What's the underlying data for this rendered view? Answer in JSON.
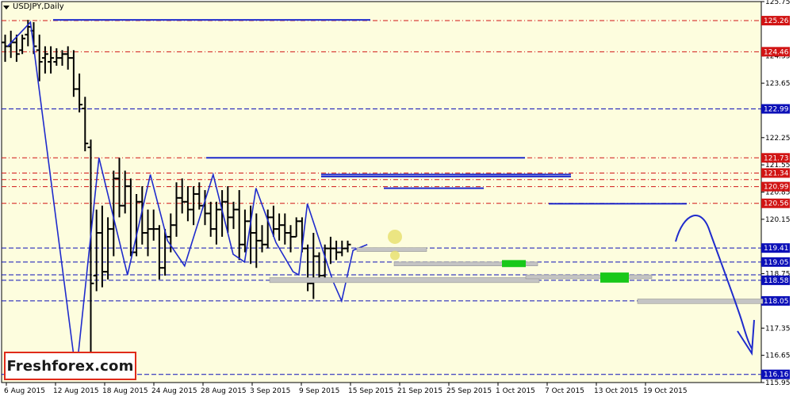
{
  "window": {
    "symbol": "USDJPY,Daily"
  },
  "logo": {
    "text": "Freshforex.com"
  },
  "colors": {
    "background": "#fdfdde",
    "frame": "#000000",
    "bar": "#000000",
    "level_red": "#d11414",
    "level_blue": "#0c10b8",
    "trend_line": "#1f2bcc",
    "support_box": "#c4c4c4",
    "highlight_green": "#18c81a",
    "highlight_yellow": "#e6df6a"
  },
  "chart_data": {
    "type": "bar",
    "title": "USDJPY,Daily",
    "xlabel": "",
    "ylabel": "",
    "ylim": [
      115.95,
      125.75
    ],
    "grid": false,
    "x_tick_labels": [
      {
        "label": "6 Aug 2015",
        "index": 0
      },
      {
        "label": "12 Aug 2015",
        "index": 4
      },
      {
        "label": "18 Aug 2015",
        "index": 8
      },
      {
        "label": "24 Aug 2015",
        "index": 12
      },
      {
        "label": "28 Aug 2015",
        "index": 16
      },
      {
        "label": "3 Sep 2015",
        "index": 20
      },
      {
        "label": "9 Sep 2015",
        "index": 24
      },
      {
        "label": "15 Sep 2015",
        "index": 28
      },
      {
        "label": "21 Sep 2015",
        "index": 32
      },
      {
        "label": "25 Sep 2015",
        "index": 36
      },
      {
        "label": "1 Oct 2015",
        "index": 40
      },
      {
        "label": "7 Oct 2015",
        "index": 44
      },
      {
        "label": "13 Oct 2015",
        "index": 48
      },
      {
        "label": "19 Oct 2015",
        "index": 52
      }
    ],
    "y_ticks": [
      "125.75",
      "124.35",
      "123.65",
      "122.25",
      "121.55",
      "120.85",
      "120.15",
      "119.45",
      "118.75",
      "117.35",
      "116.65",
      "115.95"
    ],
    "levels": [
      {
        "value": 125.26,
        "label": "125.26",
        "color": "red"
      },
      {
        "value": 124.46,
        "label": "124.46",
        "color": "red"
      },
      {
        "value": 122.99,
        "label": "122.99",
        "color": "blue"
      },
      {
        "value": 121.73,
        "label": "121.73",
        "color": "red"
      },
      {
        "value": 121.34,
        "label": "121.34",
        "color": "red"
      },
      {
        "value": 121.17,
        "label": "",
        "color": "red"
      },
      {
        "value": 120.99,
        "label": "120.99",
        "color": "red"
      },
      {
        "value": 120.56,
        "label": "120.56",
        "color": "red"
      },
      {
        "value": 119.41,
        "label": "119.41",
        "color": "blue"
      },
      {
        "value": 119.05,
        "label": "119.05",
        "color": "blue"
      },
      {
        "value": 118.72,
        "label": "",
        "color": "blue"
      },
      {
        "value": 118.58,
        "label": "118.58",
        "color": "blue"
      },
      {
        "value": 118.05,
        "label": "118.05",
        "color": "blue"
      },
      {
        "value": 116.16,
        "label": "116.16",
        "color": "blue"
      }
    ],
    "series": [
      {
        "name": "USDJPY",
        "ohlc": [
          [
            124.7,
            124.9,
            124.2,
            124.6
          ],
          [
            124.6,
            125.0,
            124.3,
            124.7
          ],
          [
            124.7,
            124.9,
            124.2,
            124.4
          ],
          [
            124.5,
            124.9,
            124.4,
            124.8
          ],
          [
            124.9,
            125.28,
            124.6,
            125.1
          ],
          [
            125.0,
            125.22,
            124.4,
            124.6
          ],
          [
            124.5,
            124.9,
            123.7,
            124.2
          ],
          [
            124.3,
            124.6,
            123.9,
            124.4
          ],
          [
            124.2,
            124.6,
            123.9,
            124.3
          ],
          [
            124.2,
            124.55,
            124.1,
            124.3
          ],
          [
            124.3,
            124.5,
            124.1,
            124.4
          ],
          [
            124.4,
            124.6,
            124.0,
            124.3
          ],
          [
            124.3,
            124.5,
            123.3,
            123.5
          ],
          [
            123.5,
            123.9,
            122.9,
            123.1
          ],
          [
            123.0,
            123.3,
            121.9,
            122.1
          ],
          [
            122.0,
            122.2,
            116.16,
            118.5
          ],
          [
            118.7,
            120.4,
            118.3,
            119.8
          ],
          [
            119.8,
            120.5,
            118.4,
            118.8
          ],
          [
            118.8,
            120.2,
            118.6,
            119.9
          ],
          [
            119.9,
            121.4,
            119.2,
            121.2
          ],
          [
            121.2,
            121.73,
            120.2,
            120.5
          ],
          [
            120.5,
            121.4,
            120.3,
            121.0
          ],
          [
            121.0,
            121.2,
            119.2,
            119.3
          ],
          [
            119.3,
            120.8,
            119.2,
            120.6
          ],
          [
            120.6,
            121.0,
            119.5,
            119.8
          ],
          [
            119.8,
            120.4,
            119.2,
            119.9
          ],
          [
            119.9,
            120.4,
            119.6,
            119.9
          ],
          [
            119.9,
            120.0,
            118.6,
            118.9
          ],
          [
            118.9,
            119.9,
            118.7,
            119.7
          ],
          [
            119.7,
            120.3,
            119.3,
            120.0
          ],
          [
            120.0,
            121.1,
            119.7,
            120.7
          ],
          [
            120.7,
            121.2,
            120.3,
            120.6
          ],
          [
            120.6,
            121.0,
            120.1,
            120.4
          ],
          [
            120.4,
            121.0,
            120.0,
            120.8
          ],
          [
            120.8,
            121.1,
            120.4,
            120.5
          ],
          [
            120.5,
            120.9,
            120.0,
            120.3
          ],
          [
            120.3,
            120.6,
            119.7,
            119.9
          ],
          [
            119.9,
            120.6,
            119.5,
            120.4
          ],
          [
            120.4,
            120.9,
            119.7,
            120.6
          ],
          [
            120.6,
            121.0,
            119.8,
            120.2
          ],
          [
            120.2,
            120.6,
            119.9,
            120.4
          ],
          [
            120.4,
            120.9,
            119.1,
            119.5
          ],
          [
            119.5,
            120.4,
            119.3,
            120.1
          ],
          [
            120.1,
            120.5,
            119.0,
            119.8
          ],
          [
            119.8,
            120.3,
            118.9,
            119.6
          ],
          [
            119.6,
            120.0,
            119.3,
            119.5
          ],
          [
            119.5,
            120.4,
            119.4,
            120.2
          ],
          [
            120.2,
            120.5,
            119.7,
            119.9
          ],
          [
            119.9,
            120.3,
            119.6,
            120.0
          ],
          [
            120.0,
            120.3,
            119.5,
            119.8
          ],
          [
            119.8,
            120.0,
            119.3,
            119.7
          ],
          [
            119.7,
            120.2,
            119.7,
            120.1
          ],
          [
            120.1,
            120.2,
            119.3,
            119.4
          ],
          [
            119.4,
            119.5,
            118.3,
            118.5
          ],
          [
            118.5,
            119.8,
            118.1,
            119.2
          ],
          [
            119.2,
            119.3,
            118.6,
            118.7
          ],
          [
            118.7,
            119.5,
            118.6,
            119.4
          ],
          [
            119.4,
            119.7,
            119.0,
            119.4
          ],
          [
            119.4,
            119.6,
            119.1,
            119.3
          ],
          [
            119.3,
            119.6,
            119.2,
            119.4
          ],
          [
            119.4,
            119.6,
            119.3,
            119.5
          ]
        ]
      }
    ],
    "zigzag": [
      [
        0,
        124.6
      ],
      [
        8,
        125.22
      ],
      [
        24,
        116.16
      ],
      [
        32,
        121.73
      ],
      [
        42,
        118.72
      ],
      [
        50,
        121.3
      ],
      [
        56,
        119.6
      ],
      [
        62,
        118.95
      ],
      [
        72,
        121.3
      ],
      [
        79,
        119.25
      ],
      [
        83,
        119.05
      ],
      [
        87,
        120.95
      ],
      [
        94,
        119.55
      ],
      [
        100,
        118.8
      ],
      [
        102,
        118.72
      ],
      [
        105,
        120.55
      ],
      [
        114,
        118.55
      ],
      [
        117,
        118.05
      ],
      [
        121,
        119.35
      ],
      [
        126,
        119.5
      ]
    ],
    "projection": {
      "description": "",
      "points": [
        [
          126,
          119.5
        ],
        [
          131,
          120.3
        ],
        [
          133,
          120.0
        ],
        [
          137,
          118.5
        ],
        [
          139,
          117.8
        ],
        [
          143,
          116.7
        ]
      ]
    }
  }
}
